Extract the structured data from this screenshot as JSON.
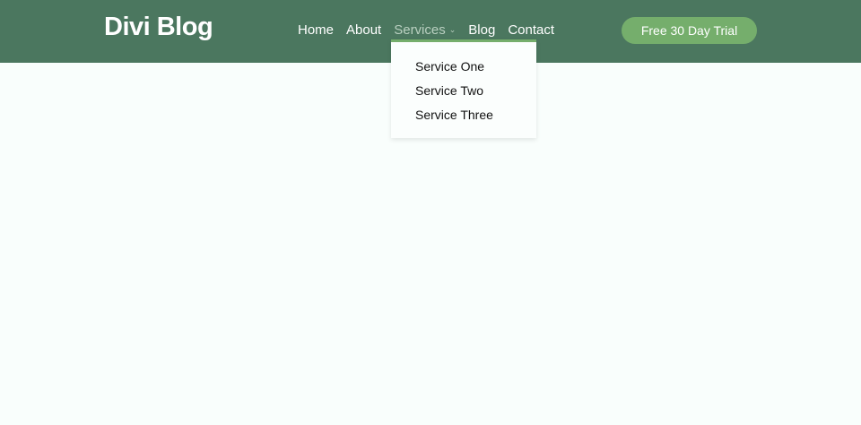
{
  "header": {
    "logo": "Divi Blog",
    "cta_label": "Free 30 Day Trial"
  },
  "nav": [
    {
      "label": "Home"
    },
    {
      "label": "About"
    },
    {
      "label": "Services"
    },
    {
      "label": "Blog"
    },
    {
      "label": "Contact"
    }
  ],
  "dropdown": [
    {
      "label": "Service One"
    },
    {
      "label": "Service Two"
    },
    {
      "label": "Service Three"
    }
  ],
  "colors": {
    "header": "#4b775f",
    "accent": "#75ae6c",
    "background": "#f9fefc"
  }
}
